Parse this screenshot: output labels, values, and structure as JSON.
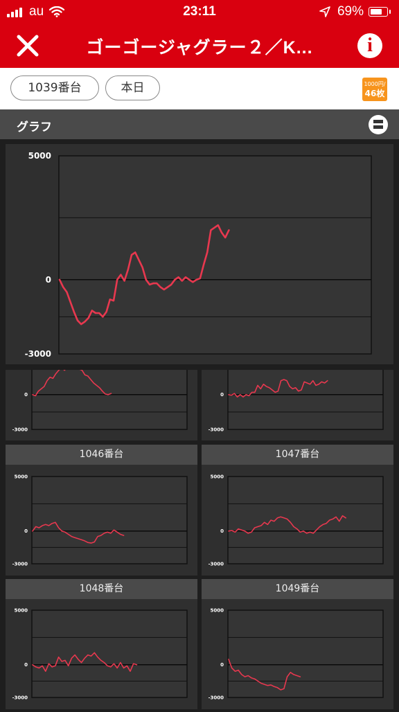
{
  "status_bar": {
    "carrier": "au",
    "time": "23:11",
    "battery": "69%"
  },
  "header": {
    "title": "ゴーゴージャグラー２／K..."
  },
  "filters": {
    "machine": "1039番台",
    "day": "本日"
  },
  "rate_badge": {
    "rate": "1000円/",
    "coins": "46枚"
  },
  "section": {
    "title": "グラフ"
  },
  "colors": {
    "accent": "#d9000f",
    "line": "#e8384f",
    "badge": "#f7941d"
  },
  "graphs": [
    {
      "id": "1039",
      "label": "",
      "y_ticks": [
        "5000",
        "0",
        "-3000"
      ]
    },
    {
      "id": "p1",
      "label": "",
      "y_ticks": [
        "",
        "0",
        "-3000"
      ]
    },
    {
      "id": "p2",
      "label": "",
      "y_ticks": [
        "",
        "0",
        "-3000"
      ]
    },
    {
      "id": "1046",
      "label": "1046番台",
      "y_ticks": [
        "5000",
        "0",
        "-3000"
      ]
    },
    {
      "id": "1047",
      "label": "1047番台",
      "y_ticks": [
        "5000",
        "0",
        "-3000"
      ]
    },
    {
      "id": "1048",
      "label": "1048番台",
      "y_ticks": [
        "5000",
        "0",
        "-3000"
      ]
    },
    {
      "id": "1049",
      "label": "1049番台",
      "y_ticks": [
        "5000",
        "0",
        "-3000"
      ]
    }
  ],
  "chart_data": [
    {
      "type": "line",
      "ylim": [
        -3000,
        5000
      ],
      "series": [
        {
          "values": [
            0,
            -300,
            -500,
            -900,
            -1300,
            -1650,
            -1800,
            -1700,
            -1550,
            -1250,
            -1350,
            -1350,
            -1500,
            -1300,
            -800,
            -850,
            0,
            200,
            -50,
            400,
            1000,
            1100,
            800,
            500,
            0,
            -200,
            -150,
            -150,
            -300,
            -400,
            -300,
            -200,
            0,
            100,
            -50,
            100,
            0,
            -100,
            0,
            50,
            600,
            1100,
            2000,
            2100,
            2200,
            1900,
            1700,
            2000
          ]
        }
      ]
    },
    {
      "type": "line",
      "ylim": [
        -3000,
        5000
      ],
      "series": [
        {
          "values": [
            0,
            -100,
            300,
            500,
            700,
            1200,
            1500,
            1400,
            1800,
            2100,
            2300,
            2100,
            2400,
            2600,
            2300,
            2600,
            2200,
            2100,
            1700,
            1600,
            1300,
            1000,
            800,
            600,
            300,
            50,
            0,
            100
          ]
        }
      ]
    },
    {
      "type": "line",
      "ylim": [
        -3000,
        5000
      ],
      "series": [
        {
          "values": [
            0,
            -50,
            100,
            -200,
            0,
            -200,
            0,
            -100,
            200,
            200,
            800,
            500,
            900,
            700,
            600,
            400,
            200,
            300,
            1200,
            1300,
            1200,
            700,
            500,
            600,
            300,
            400,
            1100,
            1000,
            900,
            1200,
            800,
            900,
            1100,
            1000,
            1200
          ]
        }
      ]
    },
    {
      "type": "line",
      "ylim": [
        -3000,
        5000
      ],
      "series": [
        {
          "values": [
            0,
            400,
            300,
            500,
            600,
            500,
            700,
            800,
            300,
            0,
            -100,
            -300,
            -500,
            -600,
            -700,
            -800,
            -900,
            -1050,
            -1100,
            -1000,
            -500,
            -400,
            -200,
            -100,
            -200,
            100,
            -100,
            -300,
            -400
          ]
        }
      ]
    },
    {
      "type": "line",
      "ylim": [
        -3000,
        5000
      ],
      "series": [
        {
          "values": [
            0,
            50,
            -100,
            200,
            100,
            0,
            -200,
            -100,
            300,
            400,
            500,
            800,
            600,
            1000,
            900,
            1200,
            1300,
            1200,
            1100,
            800,
            400,
            200,
            -100,
            0,
            -200,
            -100,
            -200,
            100,
            400,
            600,
            700,
            1000,
            1100,
            1300,
            900,
            1400,
            1200
          ]
        }
      ]
    },
    {
      "type": "line",
      "ylim": [
        -3000,
        5000
      ],
      "series": [
        {
          "values": [
            0,
            -200,
            -300,
            -100,
            -600,
            100,
            -200,
            -100,
            700,
            300,
            400,
            -100,
            600,
            900,
            500,
            200,
            600,
            900,
            800,
            1100,
            700,
            400,
            200,
            -100,
            -200,
            100,
            -300,
            200,
            -300,
            -100,
            -600,
            100,
            0
          ]
        }
      ]
    },
    {
      "type": "line",
      "ylim": [
        -3000,
        5000
      ],
      "series": [
        {
          "values": [
            500,
            -300,
            -600,
            -500,
            -900,
            -1100,
            -1000,
            -1200,
            -1300,
            -1500,
            -1700,
            -1800,
            -1900,
            -1850,
            -2000,
            -2100,
            -2300,
            -2200,
            -1100,
            -700,
            -900,
            -1000,
            -1100
          ]
        }
      ]
    }
  ]
}
